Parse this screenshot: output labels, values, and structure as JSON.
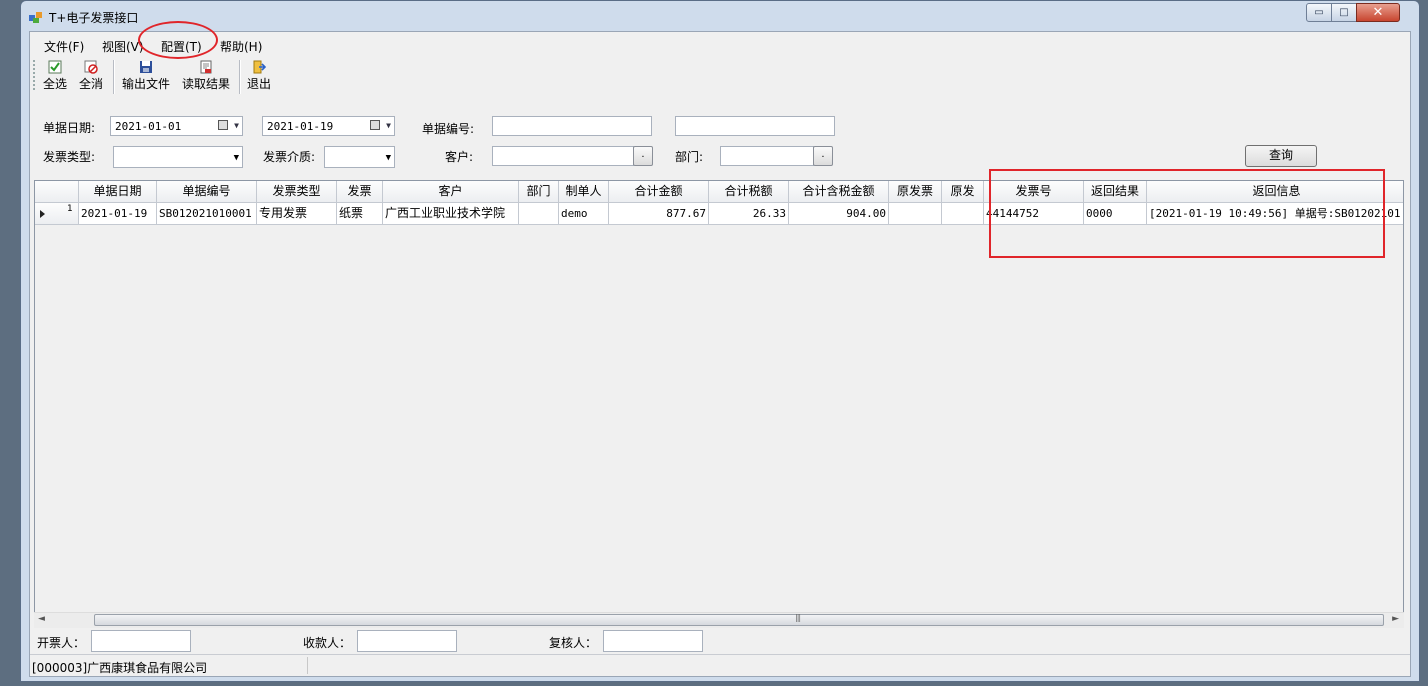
{
  "window": {
    "title": "T+电子发票接口",
    "minimize_glyph": "▭",
    "maximize_glyph": "□",
    "close_glyph": "✕"
  },
  "menu": [
    "文件(F)",
    "视图(V)",
    "配置(T)",
    "帮助(H)"
  ],
  "toolbar": {
    "select_all": "全选",
    "clear_all": "全消",
    "export_file": "输出文件",
    "read_result": "读取结果",
    "exit": "退出"
  },
  "filters": {
    "date_label": "单据日期:",
    "date_from": "2021-01-01",
    "date_to": "2021-01-19",
    "doc_no_label": "单据编号:",
    "doc_no_from": "",
    "doc_no_to": "",
    "invoice_type_label": "发票类型:",
    "invoice_type_value": "",
    "invoice_medium_label": "发票介质:",
    "invoice_medium_value": "",
    "customer_label": "客户:",
    "customer_value": "",
    "department_label": "部门:",
    "department_value": "",
    "browse_glyph": ".",
    "query_button": "查询"
  },
  "grid": {
    "columns": [
      "单据日期",
      "单据编号",
      "发票类型",
      "发票",
      "客户",
      "部门",
      "制单人",
      "合计金额",
      "合计税额",
      "合计含税金额",
      "原发票",
      "原发",
      "发票号",
      "返回结果",
      "返回信息"
    ],
    "rows": [
      {
        "index": "1",
        "cells": [
          "2021-01-19",
          "SB012021010001",
          "专用发票",
          "纸票",
          "广西工业职业技术学院",
          "",
          "demo",
          "877.67",
          "26.33",
          "904.00",
          "",
          "",
          "44144752",
          "0000",
          "[2021-01-19 10:49:56] 单据号:SB01202101..."
        ]
      }
    ]
  },
  "footer": {
    "drawer_label": "开票人：",
    "drawer_value": "",
    "payee_label": "收款人：",
    "payee_value": "",
    "reviewer_label": "复核人：",
    "reviewer_value": ""
  },
  "status": {
    "company": "[000003]广西康琪食品有限公司"
  },
  "colors": {
    "annotation": "#e0252a",
    "window_frame": "#cfdcec",
    "close_button": "#c8452f"
  },
  "icons": [
    "app-icon",
    "check-icon",
    "uncheck-icon",
    "save-icon",
    "read-result-icon",
    "exit-icon",
    "calendar-icon",
    "dropdown-arrow-icon",
    "row-pointer-icon"
  ]
}
